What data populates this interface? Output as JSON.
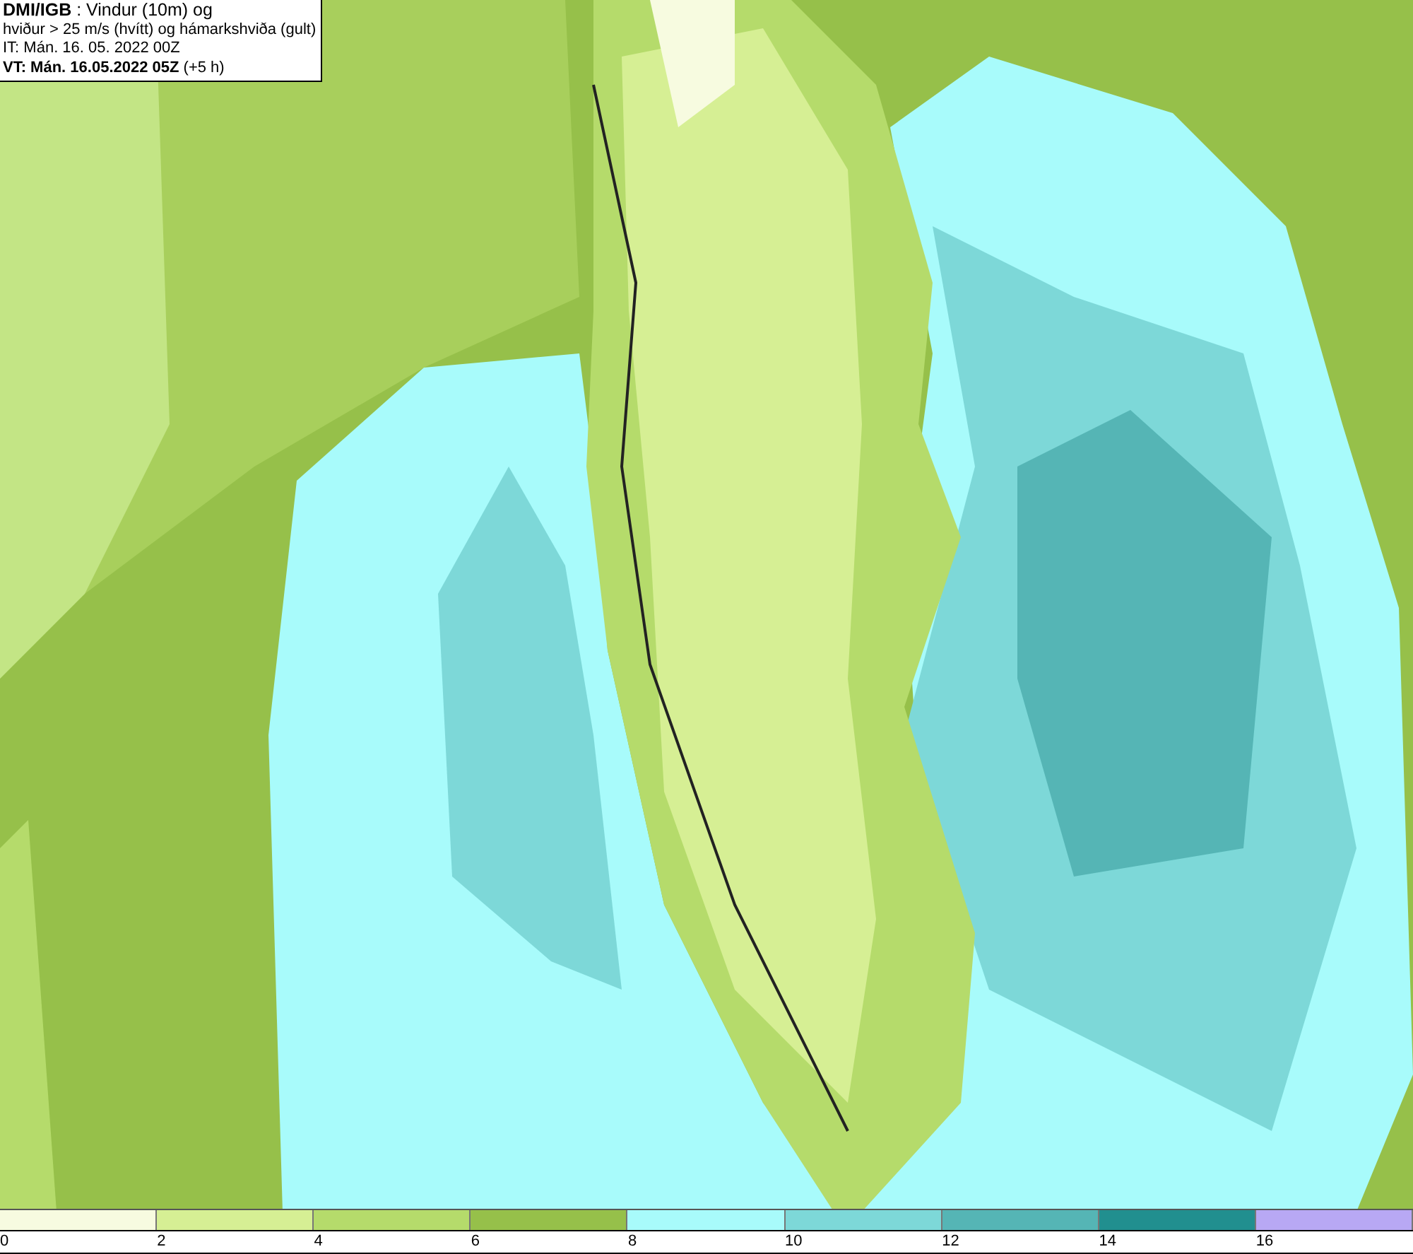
{
  "title_box": {
    "lines": [
      "**DMI/IGB** : Vindur (10m) og",
      "hviður > 25 m/s (hvítt) og hámarkshviða (gult)",
      "IT: Mán. 16. 05. 2022 00Z",
      "**VT: Mán. 16.05.2022 05Z** (+5 h)"
    ]
  },
  "legend": {
    "bins": [
      {
        "label": "0",
        "color": "#f7fbe0"
      },
      {
        "label": "2",
        "color": "#d6ef94"
      },
      {
        "label": "4",
        "color": "#b5db6b"
      },
      {
        "label": "6",
        "color": "#96c04a"
      },
      {
        "label": "8",
        "color": "#a8fbfb"
      },
      {
        "label": "10",
        "color": "#7dd8d8"
      },
      {
        "label": "12",
        "color": "#55b5b5"
      },
      {
        "label": "14",
        "color": "#218f8f"
      },
      {
        "label": "16",
        "color": "#b8a8f4"
      }
    ]
  }
}
